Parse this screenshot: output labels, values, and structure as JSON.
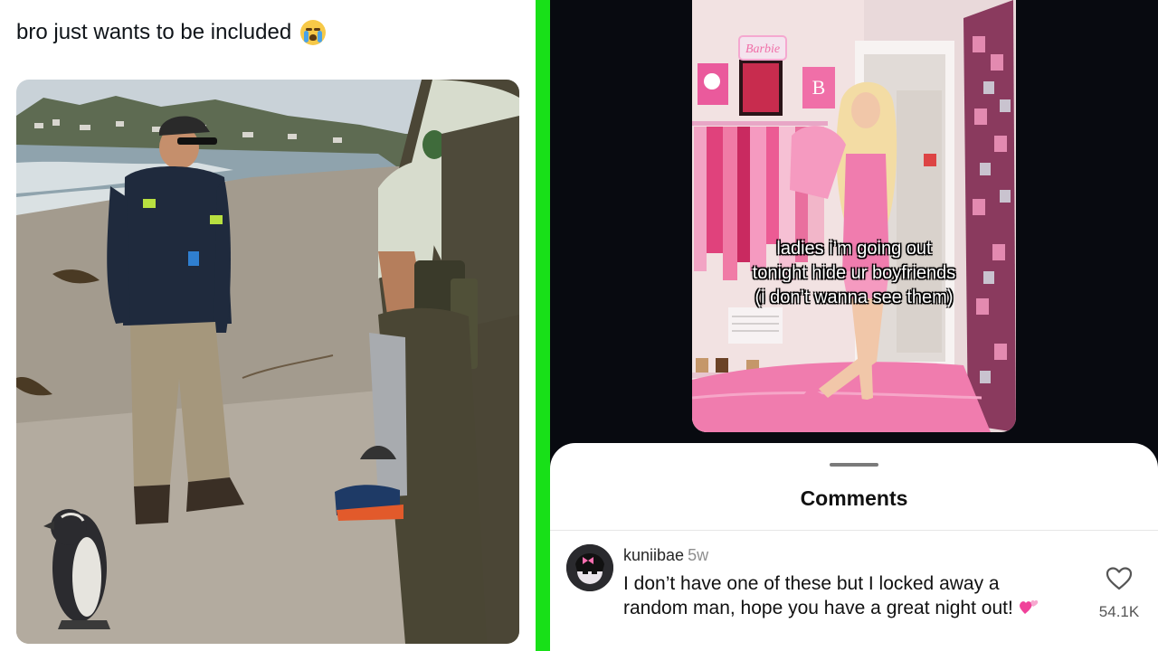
{
  "tweet": {
    "text": "bro just wants to be included",
    "emoji": "loudly-crying-face"
  },
  "video": {
    "caption_lines": [
      "ladies i’m going out",
      "tonight hide ur boyfriends",
      "(i don’t wanna see them)"
    ]
  },
  "comments": {
    "title": "Comments",
    "items": [
      {
        "username": "kuniibae",
        "age": "5w",
        "text": "I don’t have one of these but I locked away a random man, hope you have a great night out!",
        "emoji": "two-hearts",
        "likes": "54.1K"
      }
    ]
  },
  "colors": {
    "divider": "#18e018",
    "right_bg": "#080a10",
    "pink": "#f472b6"
  }
}
